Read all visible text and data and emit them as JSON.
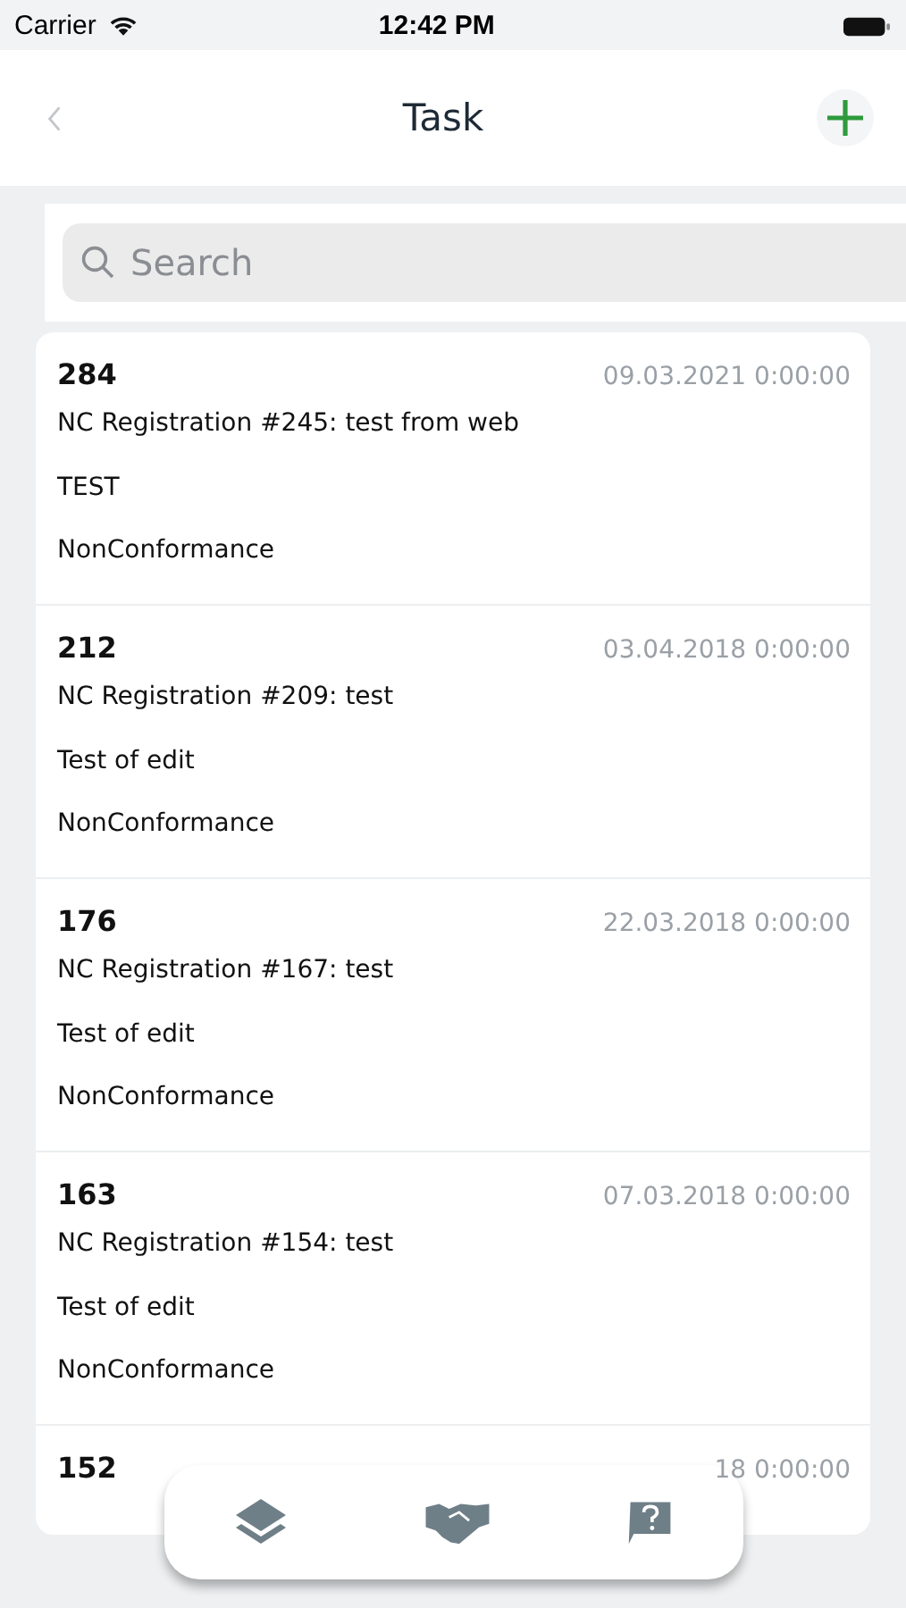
{
  "status_bar": {
    "carrier": "Carrier",
    "time": "12:42 PM"
  },
  "nav": {
    "title": "Task"
  },
  "search": {
    "placeholder": "Search"
  },
  "tasks": [
    {
      "number": "284",
      "date": "09.03.2021 0:00:00",
      "title": "NC Registration #245: test from web",
      "description": "TEST",
      "type": "NonConformance"
    },
    {
      "number": "212",
      "date": "03.04.2018 0:00:00",
      "title": "NC Registration #209: test",
      "description": "Test of edit",
      "type": "NonConformance"
    },
    {
      "number": "176",
      "date": "22.03.2018 0:00:00",
      "title": "NC Registration #167: test",
      "description": "Test of edit",
      "type": "NonConformance"
    },
    {
      "number": "163",
      "date": "07.03.2018 0:00:00",
      "title": "NC Registration #154: test",
      "description": "Test of edit",
      "type": "NonConformance"
    },
    {
      "number": "152",
      "date": "18 0:00:00"
    }
  ],
  "tab_bar": [
    {
      "kind": "layers"
    },
    {
      "kind": "handshake"
    },
    {
      "kind": "help"
    }
  ]
}
